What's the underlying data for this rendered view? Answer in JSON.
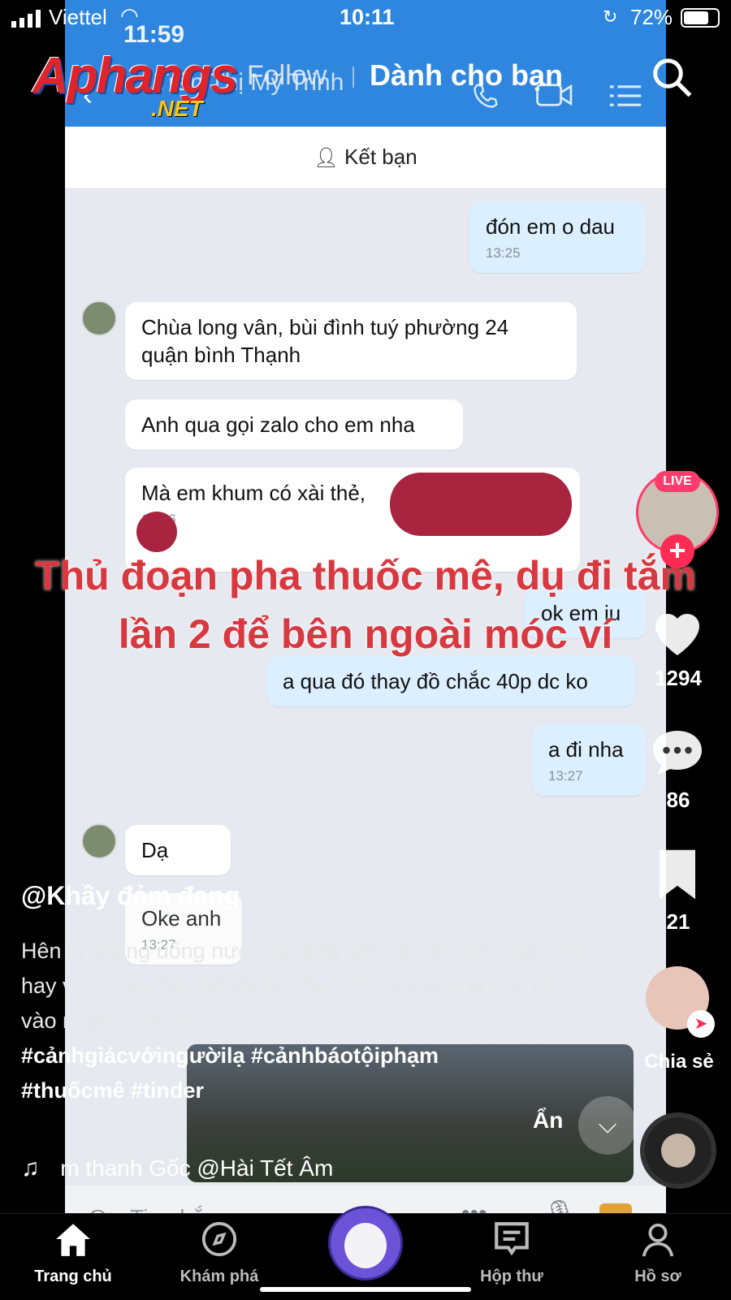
{
  "status_bar": {
    "carrier": "Viettel",
    "time": "10:11",
    "battery_pct": "72%"
  },
  "embedded_screenshot": {
    "time": "11:59",
    "contact_name": "Trần Thị Mỹ Trinh",
    "add_friend": "Kết bạn",
    "messages": [
      {
        "text": "đón em o dau",
        "time": "13:25",
        "me": true
      },
      {
        "text": "Chùa long vân, bùi đình tuý phường 24 quận bình Thạnh",
        "time": "",
        "me": false
      },
      {
        "text": "Anh qua gọi zalo cho em nha",
        "time": "",
        "me": false
      },
      {
        "text": "Mà em khum có xài thẻ,",
        "time": "13:26",
        "me": false
      },
      {
        "text": "ok em iu",
        "time": "",
        "me": true
      },
      {
        "text": "a qua đó thay đồ chắc 40p dc ko",
        "time": "",
        "me": true
      },
      {
        "text": "a đi nha",
        "time": "13:27",
        "me": true
      },
      {
        "text": "Dạ",
        "time": "",
        "me": false
      },
      {
        "text": "Oke anh",
        "time": "13:27",
        "me": false
      }
    ],
    "input_placeholder": "Tin nhắn"
  },
  "overlay_caption": "Thủ đoạn pha thuốc mê, dụ đi tắm lần 2 để bên ngoài móc ví",
  "watermark": {
    "logo": "Aphangs",
    "suffix": ".NET"
  },
  "top_tabs": {
    "following": "Follow",
    "for_you": "Dành cho bạn"
  },
  "rail": {
    "live_label": "LIVE",
    "likes": "1294",
    "comments": "86",
    "saves": "21",
    "share_label": "Chia sẻ",
    "hide_label": "Ẩn"
  },
  "post": {
    "username": "@Khầy đảm đang",
    "description": "Hên là không uống nước nó đưa nên xe vẫn còn, mấy em hay vào nhận bạn bè dù đã che mặt, nay không che có gì vào nhận dùm nhé",
    "hashtags_line1": "#cảnhgiácvớingườilạ #cảnhbáotộiphạm",
    "hashtags_line2": "#thuốcmê #tinder",
    "music": "m thanh Gốc   @Hài Tết Âm"
  },
  "bottom_nav": {
    "home": "Trang chủ",
    "discover": "Khám phá",
    "inbox": "Hộp thư",
    "profile": "Hồ sơ"
  },
  "colors": {
    "zalo_blue": "#2f86de",
    "tiktok_red": "#fe2c55",
    "caption_red": "#d8383f",
    "redaction": "#a9243f"
  }
}
